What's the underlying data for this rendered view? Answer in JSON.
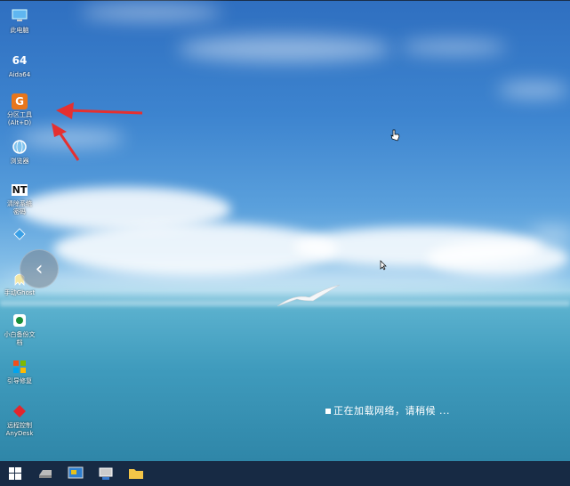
{
  "desktop_icons": [
    {
      "label": "此电脑",
      "icon": "computer-icon"
    },
    {
      "label": "Aida64",
      "icon": "aida64-icon",
      "glyph": "64"
    },
    {
      "label": "分区工具\n(Alt+D)",
      "icon": "partition-tool-icon",
      "glyph": "G"
    },
    {
      "label": "浏览器",
      "icon": "browser-icon"
    },
    {
      "label": "清除系统\n密码",
      "icon": "password-clear-icon",
      "glyph": "NT"
    },
    {
      "label": "",
      "icon": "app-icon"
    },
    {
      "label": "手动Ghost",
      "icon": "ghost-icon"
    },
    {
      "label": "小白备份文\n档",
      "icon": "backup-icon"
    },
    {
      "label": "引导修复",
      "icon": "boot-repair-icon"
    },
    {
      "label": "远程控制\nAnyDesk",
      "icon": "anydesk-icon"
    }
  ],
  "status_text": "正在加载网络，请稍候 ...",
  "taskbar_items": [
    "windows-start-icon",
    "drive-icon",
    "monitor-app-icon",
    "network-app-icon",
    "folder-icon"
  ],
  "colors": {
    "taskbar": "#172a44",
    "arrow": "#e53030"
  }
}
